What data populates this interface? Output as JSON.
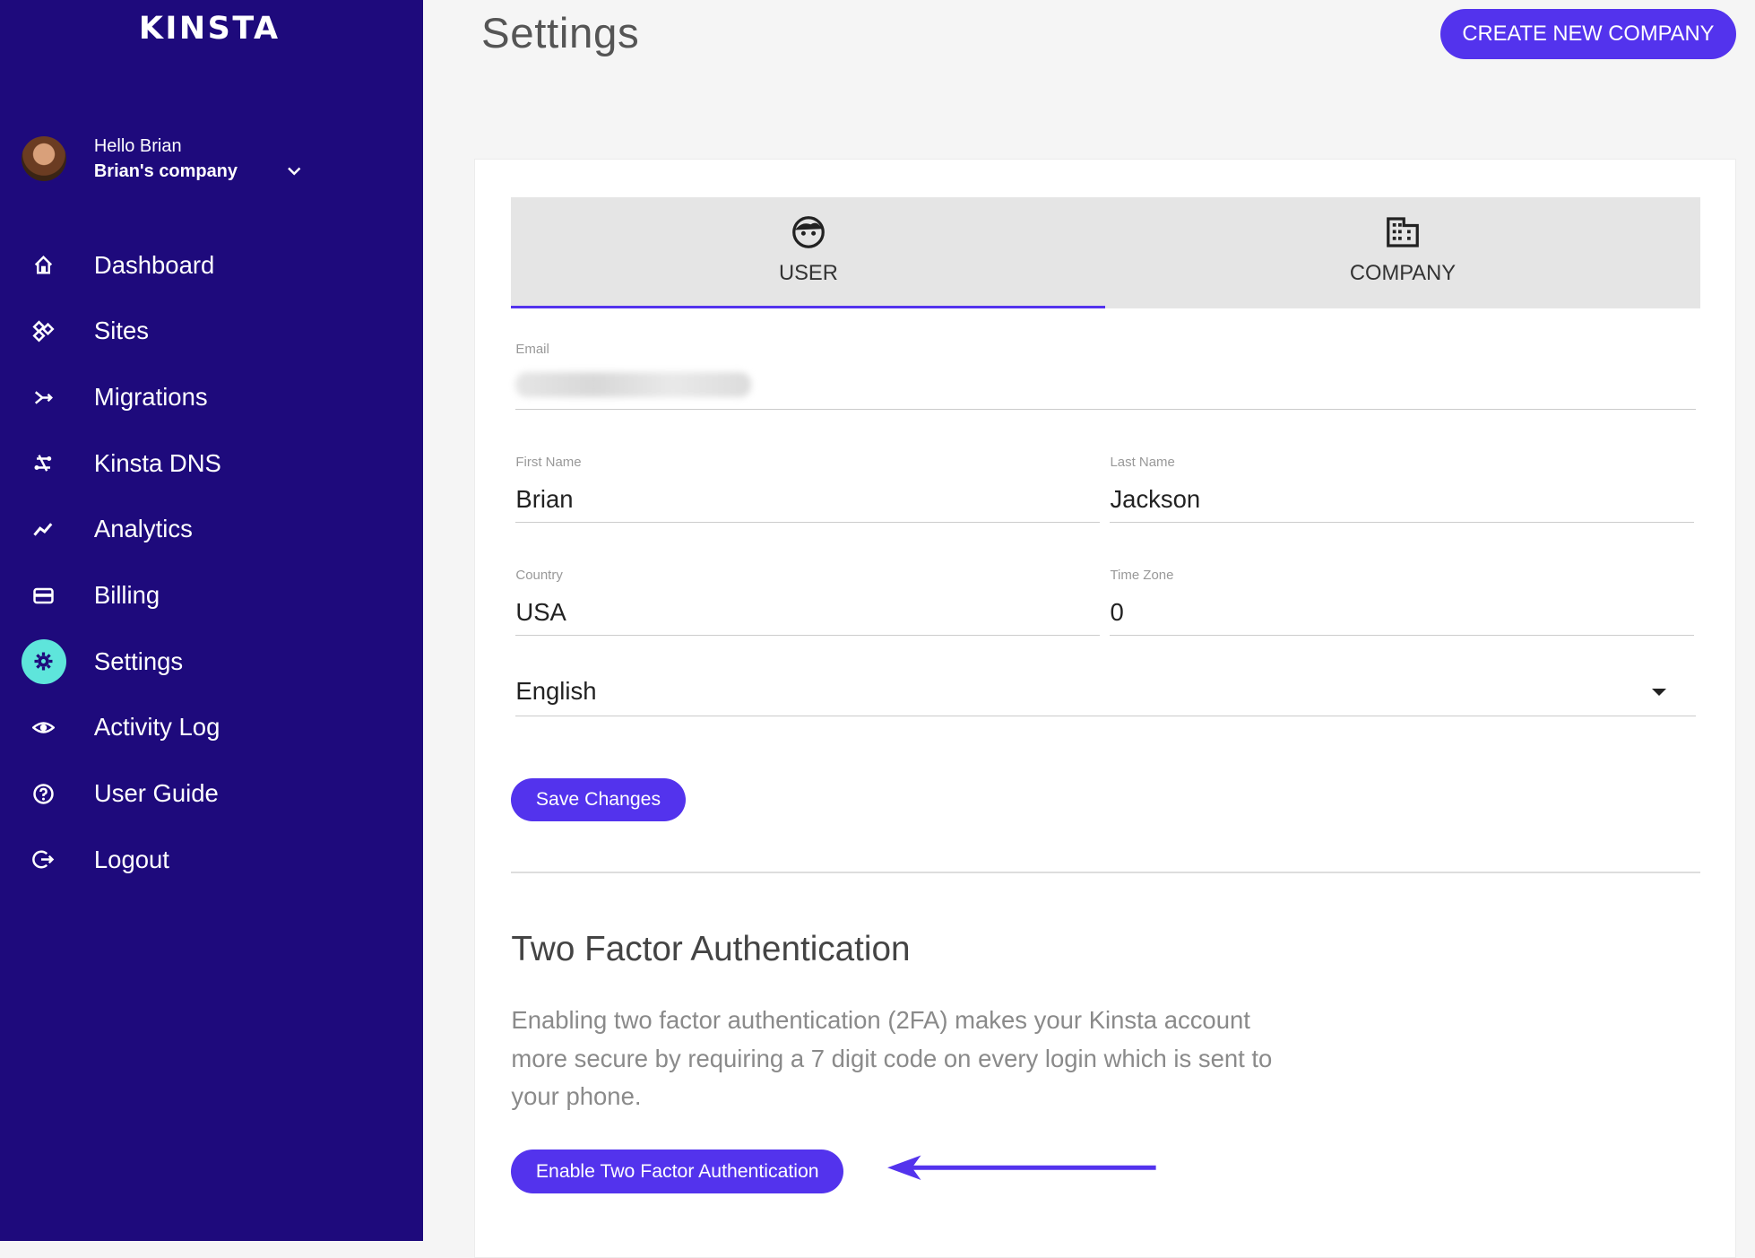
{
  "brand": {
    "logo_text": "KINSTA",
    "accent": "#5333ed",
    "sidebar_bg": "#1e0a7c",
    "active_icon_bg": "#5ee5db"
  },
  "user": {
    "greeting": "Hello Brian",
    "company": "Brian's company"
  },
  "sidebar": {
    "items": [
      {
        "label": "Dashboard",
        "icon": "home-icon"
      },
      {
        "label": "Sites",
        "icon": "sites-icon"
      },
      {
        "label": "Migrations",
        "icon": "migrations-icon"
      },
      {
        "label": "Kinsta DNS",
        "icon": "dns-icon"
      },
      {
        "label": "Analytics",
        "icon": "analytics-icon"
      },
      {
        "label": "Billing",
        "icon": "billing-icon"
      },
      {
        "label": "Settings",
        "icon": "gear-icon",
        "active": true
      },
      {
        "label": "Activity Log",
        "icon": "eye-icon"
      },
      {
        "label": "User Guide",
        "icon": "help-icon"
      },
      {
        "label": "Logout",
        "icon": "logout-icon"
      }
    ]
  },
  "header": {
    "title": "Settings",
    "create_company": "CREATE NEW COMPANY"
  },
  "tabs": [
    {
      "label": "USER",
      "icon": "face-icon",
      "active": true
    },
    {
      "label": "COMPANY",
      "icon": "building-icon"
    }
  ],
  "form": {
    "email": {
      "label": "Email",
      "value": ""
    },
    "first_name": {
      "label": "First Name",
      "value": "Brian"
    },
    "last_name": {
      "label": "Last Name",
      "value": "Jackson"
    },
    "country": {
      "label": "Country",
      "value": "USA"
    },
    "time_zone": {
      "label": "Time Zone",
      "value": "0"
    },
    "language": {
      "value": "English"
    },
    "save_label": "Save Changes"
  },
  "tfa": {
    "title": "Two Factor Authentication",
    "description": "Enabling two factor authentication (2FA) makes your Kinsta account more secure by requiring a 7 digit code on every login which is sent to your phone.",
    "button": "Enable Two Factor Authentication"
  }
}
